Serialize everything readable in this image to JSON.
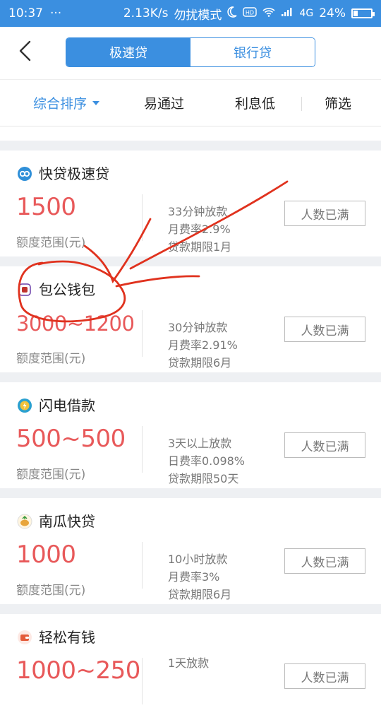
{
  "status_bar": {
    "time": "10:37",
    "dots": "···",
    "speed": "2.13K/s",
    "mode": "勿扰模式",
    "network": "4G",
    "battery_percent": "24%",
    "battery_level": 0.24
  },
  "header": {
    "back_icon": "chevron-left-icon",
    "tabs": [
      {
        "label": "极速贷",
        "active": true
      },
      {
        "label": "银行贷",
        "active": false
      }
    ]
  },
  "filters": [
    {
      "label": "综合排序",
      "active": true
    },
    {
      "label": "易通过",
      "active": false
    },
    {
      "label": "利息低",
      "active": false
    },
    {
      "label": "筛选",
      "active": false
    }
  ],
  "range_label": "额度范围(元)",
  "loans": [
    {
      "name": "快贷极速贷",
      "amount": "1500",
      "info": [
        "33分钟放款",
        "月费率2.9%",
        "贷款期限1月"
      ],
      "status": "人数已满",
      "icon_color": "#2f8fd8"
    },
    {
      "name": "包公钱包",
      "amount": "3000~1200",
      "info": [
        "30分钟放款",
        "月费率2.91%",
        "贷款期限6月"
      ],
      "status": "人数已满",
      "icon_color": "#6a3fa8"
    },
    {
      "name": "闪电借款",
      "amount": "500~500",
      "info": [
        "3天以上放款",
        "日费率0.098%",
        "贷款期限50天"
      ],
      "status": "人数已满",
      "icon_color": "#2aa0d0"
    },
    {
      "name": "南瓜快贷",
      "amount": "1000",
      "info": [
        "10小时放款",
        "月费率3%",
        "贷款期限6月"
      ],
      "status": "人数已满",
      "icon_color": "#e8a53b"
    },
    {
      "name": "轻松有钱",
      "amount": "1000~250",
      "info": [
        "1天放款",
        "",
        ""
      ],
      "status": "人数已满",
      "icon_color": "#e35b3a"
    }
  ],
  "colors": {
    "primary": "#3b8fe0",
    "amount_red": "#e8595a",
    "annotation_red": "#e0321e"
  }
}
